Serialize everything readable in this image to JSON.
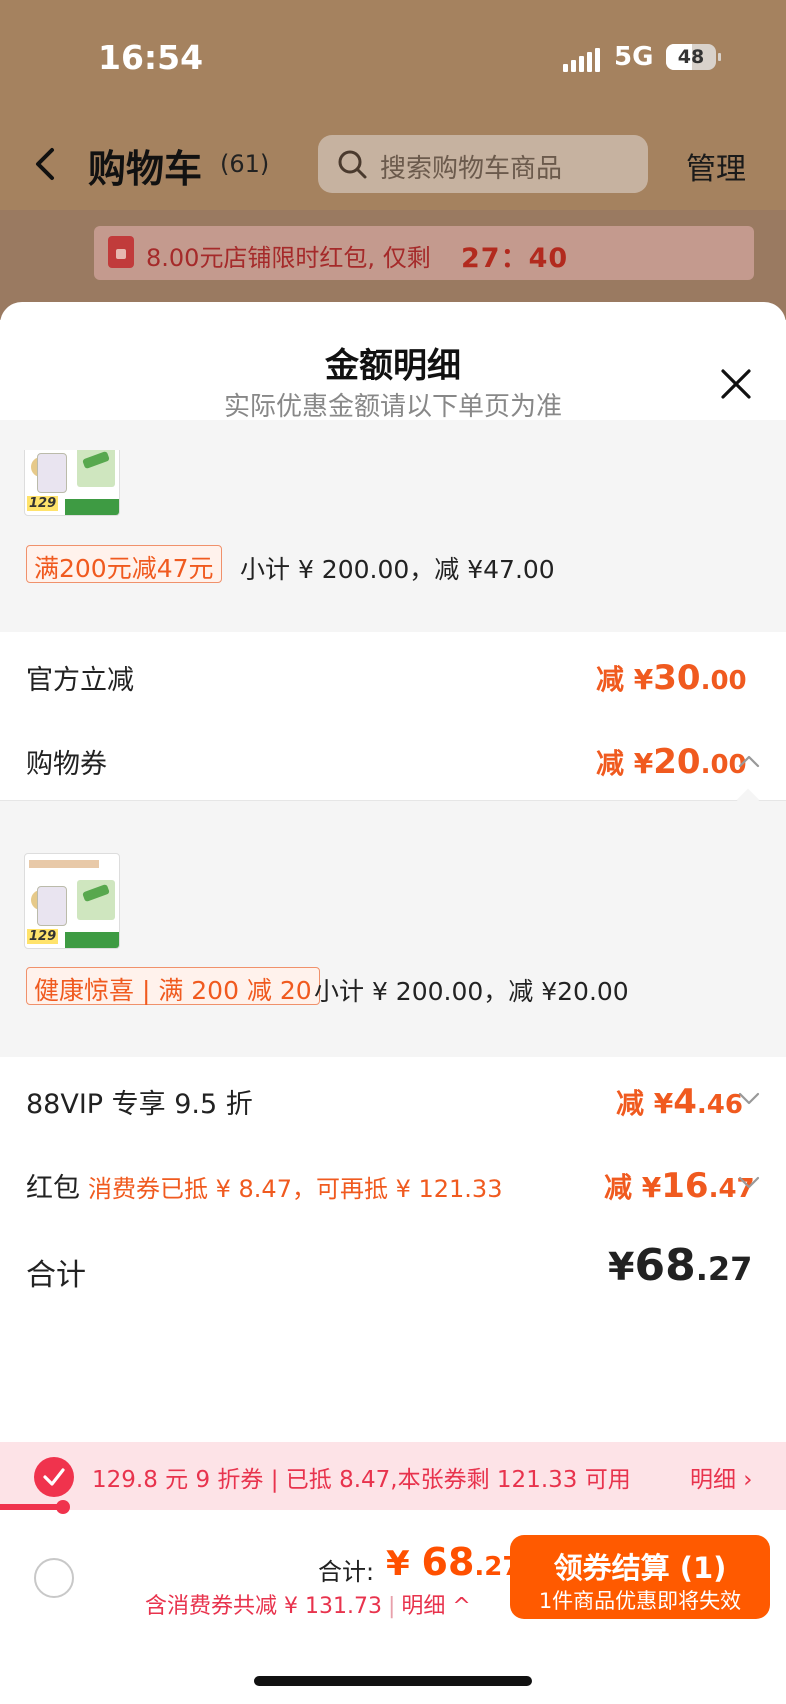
{
  "status_bar": {
    "time": "16:54",
    "network": "5G",
    "battery": "48"
  },
  "nav": {
    "title": "购物车",
    "count": "(61)",
    "search_placeholder": "搜索购物车商品",
    "manage": "管理"
  },
  "banner": {
    "text": "8.00元店铺限时红包, 仅剩",
    "timer": "27：40"
  },
  "sheet": {
    "title": "金额明细",
    "subtitle": "实际优惠金额请以下单页为准",
    "group1": {
      "thumb_price": "129",
      "tag": "满200元减47元",
      "subtotal": "小计 ¥ 200.00，减 ¥47.00"
    },
    "official": {
      "label": "官方立减",
      "prefix": "减 ¥",
      "int": "30",
      "dec": ".00"
    },
    "voucher": {
      "label": "购物券",
      "prefix": "减 ¥",
      "int": "20",
      "dec": ".00"
    },
    "group2": {
      "thumb_price": "129",
      "tag": "健康惊喜 | 满 200 减 20",
      "subtotal": "小计 ¥ 200.00，减 ¥20.00"
    },
    "vip": {
      "label": "88VIP 专享 9.5 折",
      "prefix": "减 ¥",
      "int": "4",
      "dec": ".46"
    },
    "redpack": {
      "label": "红包",
      "note": "消费券已抵 ¥ 8.47，可再抵 ¥ 121.33",
      "prefix": "减 ¥",
      "int": "16",
      "dec": ".47"
    },
    "total": {
      "label": "合计",
      "prefix": "¥",
      "int": "68",
      "dec": ".27"
    }
  },
  "coupon_bar": {
    "text": "129.8 元 9 折券 | 已抵 8.47,本张券剩 121.33 可用",
    "detail": "明细 ›",
    "progress": 0.08
  },
  "footer": {
    "total_label": "合计:",
    "total_prefix": "¥ ",
    "total_int": "68",
    "total_dec": ".27",
    "discount_text": "含消费券共减 ¥ 131.73",
    "sep": "|",
    "detail_link": "明细 ^",
    "checkout_label": "领券结算 (1)",
    "checkout_sub": "1件商品优惠即将失效"
  },
  "colors": {
    "accent": "#ff5000",
    "coupon_red": "#f0334d"
  }
}
